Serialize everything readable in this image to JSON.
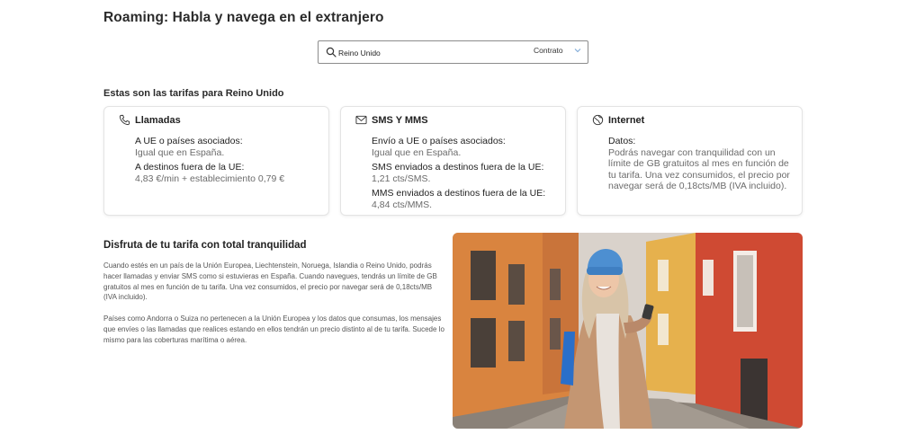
{
  "page": {
    "title": "Roaming: Habla y navega en el extranjero"
  },
  "search": {
    "value": "Reino Unido",
    "contract_label": "Contrato"
  },
  "rates_heading": "Estas son las tarifas para Reino Unido",
  "cards": {
    "calls": {
      "title": "Llamadas",
      "icon": "phone-icon",
      "label_1": "A UE o países asociados:",
      "value_1": "Igual que en España.",
      "label_2": "A destinos fuera de la UE:",
      "value_2": "4,83 €/min + establecimiento 0,79 €"
    },
    "sms": {
      "title": "SMS Y MMS",
      "icon": "envelope-icon",
      "label_1": "Envío a UE o países asociados:",
      "value_1": "Igual que en España.",
      "label_2": "SMS enviados a destinos fuera de la UE:",
      "value_2": "1,21 cts/SMS.",
      "label_3": "MMS enviados a destinos fuera de la UE:",
      "value_3": "4,84 cts/MMS."
    },
    "internet": {
      "title": "Internet",
      "icon": "globe-icon",
      "label_1": "Datos:",
      "value_1": "Podrás navegar con tranquilidad con un límite de GB gratuitos al mes en función de tu tarifa. Una vez consumidos, el precio por navegar será de 0,18cts/MB (IVA incluido)."
    }
  },
  "promo": {
    "title": "Disfruta de tu tarifa con total tranquilidad",
    "paragraph_1": "Cuando estés en un país de la Unión Europea, Liechtenstein, Noruega, Islandia o Reino Unido, podrás hacer llamadas y enviar SMS como si estuvieras en España. Cuando navegues, tendrás un límite de GB gratuitos al mes en función de tu tarifa. Una vez consumidos, el precio por navegar será de 0,18cts/MB (IVA incluido).",
    "paragraph_2": "Países como Andorra o Suiza no pertenecen a la Unión Europea y los datos que consumas, los mensajes que envíes o las llamadas que realices estando en ellos tendrán un precio distinto al de tu tarifa. Sucede lo mismo para las coberturas marítima o aérea."
  },
  "colors": {
    "text_dark": "#2b2b2b",
    "text_muted": "#6b6b6b",
    "card_border": "#e4e4e4"
  }
}
